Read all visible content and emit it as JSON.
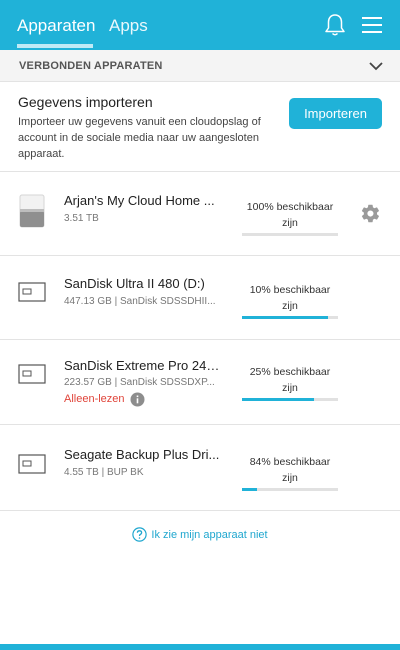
{
  "header": {
    "tabs": [
      {
        "label": "Apparaten",
        "active": true
      },
      {
        "label": "Apps",
        "active": false
      }
    ],
    "icons": [
      "bell-icon",
      "hamburger-menu-icon"
    ]
  },
  "section": {
    "title": "VERBONDEN APPARATEN",
    "toggle_icon": "chevron-down-icon"
  },
  "import": {
    "title": "Gegevens importeren",
    "description": "Importeer uw gegevens vanuit een cloudopslag of account in de sociale media naar uw aangesloten apparaat.",
    "button_label": "Importeren"
  },
  "devices": [
    {
      "name": "Arjan's My Cloud Home ...",
      "sub": "3.51 TB",
      "available": "100% beschikbaar zijn",
      "available_line1": "100% beschikbaar",
      "available_line2": "zijn",
      "used_fraction": 0.0,
      "icon": "my-cloud-home-icon",
      "has_settings": true
    },
    {
      "name": "SanDisk Ultra II 480 (D:)",
      "sub": "447.13 GB | SanDisk SDSSDHII...",
      "available_line1": "10% beschikbaar",
      "available_line2": "zijn",
      "used_fraction": 0.9,
      "icon": "drive-icon"
    },
    {
      "name": "SanDisk Extreme Pro 240...",
      "sub": "223.57 GB | SanDisk SDSSDXP...",
      "read_only": "Alleen-lezen",
      "available_line1": "25% beschikbaar",
      "available_line2": "zijn",
      "used_fraction": 0.75,
      "icon": "drive-icon"
    },
    {
      "name": "Seagate Backup Plus Dri...",
      "sub": "4.55 TB | BUP BK",
      "available_line1": "84% beschikbaar",
      "available_line2": "zijn",
      "used_fraction": 0.16,
      "icon": "drive-icon"
    }
  ],
  "help": {
    "label": "Ik zie mijn apparaat niet"
  },
  "colors": {
    "accent": "#20b2d8",
    "warning": "#e0443a"
  }
}
